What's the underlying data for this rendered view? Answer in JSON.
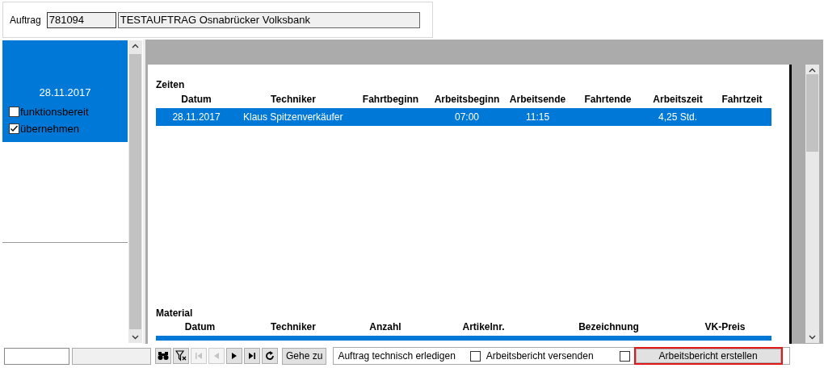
{
  "order": {
    "label": "Auftrag",
    "number": "781094",
    "name": "TESTAUFTRAG Osnabrücker Volksbank"
  },
  "list": {
    "items": [
      {
        "date": "28.11.2017",
        "selected": true,
        "checks": [
          {
            "label": "funktionsbereit",
            "checked": false
          },
          {
            "label": "übernehmen",
            "checked": true
          }
        ]
      }
    ]
  },
  "times": {
    "title": "Zeiten",
    "columns": [
      "Datum",
      "Techniker",
      "Fahrtbeginn",
      "Arbeitsbeginn",
      "Arbeitsende",
      "Fahrtende",
      "Arbeitszeit",
      "Fahrtzeit"
    ],
    "rows": [
      {
        "selected": true,
        "cells": [
          "28.11.2017",
          "Klaus Spitzenverkäufer",
          "",
          "07:00",
          "11:15",
          "",
          "4,25 Std.",
          ""
        ]
      }
    ]
  },
  "material": {
    "title": "Material",
    "columns": [
      "Datum",
      "Techniker",
      "Anzahl",
      "Artikelnr.",
      "Bezeichnung",
      "VK-Preis"
    ],
    "rows": [
      {
        "selected": true
      }
    ]
  },
  "toolbar": {
    "nav": [
      {
        "kind": "search",
        "disabled": false
      },
      {
        "kind": "filter",
        "disabled": false
      },
      {
        "kind": "first",
        "disabled": true
      },
      {
        "kind": "prev",
        "disabled": true
      },
      {
        "kind": "next",
        "disabled": false
      },
      {
        "kind": "last",
        "disabled": false
      },
      {
        "kind": "refresh",
        "disabled": false
      }
    ],
    "goto": "Gehe zu",
    "status": "Auftrag technisch erledigen",
    "checks": [
      {
        "label": "Arbeitsbericht versenden",
        "checked": false
      },
      {
        "checked": false
      }
    ],
    "action": {
      "label": "Arbeitsbericht erstellen",
      "focused": true
    }
  }
}
